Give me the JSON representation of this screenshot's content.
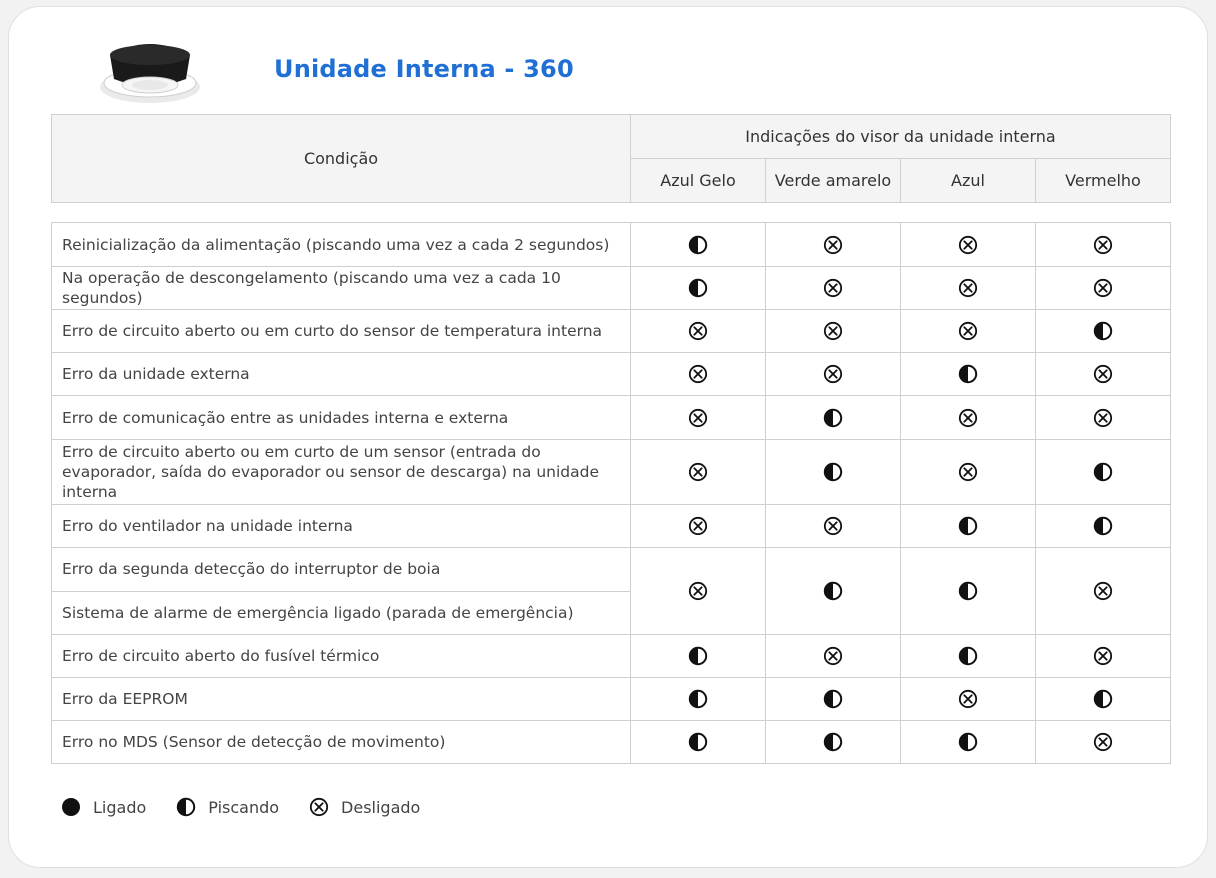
{
  "title": "Unidade Interna - 360",
  "header": {
    "condition_label": "Condição",
    "group_label": "Indicações do visor da unidade interna",
    "columns": [
      "Azul Gelo",
      "Verde amarelo",
      "Azul",
      "Vermelho"
    ]
  },
  "rows": [
    {
      "condition": "Reinicialização da alimentação (piscando uma vez a cada 2 segundos)",
      "states": [
        "blink",
        "off",
        "off",
        "off"
      ]
    },
    {
      "condition": "Na operação de descongelamento (piscando uma vez a cada 10 segundos)",
      "states": [
        "blink",
        "off",
        "off",
        "off"
      ]
    },
    {
      "condition": "Erro de circuito aberto ou em curto do sensor de temperatura interna",
      "states": [
        "off",
        "off",
        "off",
        "blink"
      ]
    },
    {
      "condition": "Erro da unidade externa",
      "states": [
        "off",
        "off",
        "blink",
        "off"
      ]
    },
    {
      "condition": "Erro de comunicação entre as unidades interna e externa",
      "states": [
        "off",
        "blink",
        "off",
        "off"
      ]
    },
    {
      "condition": "Erro de circuito aberto ou em curto de um sensor (entrada do evaporador, saída do evaporador ou sensor de descarga) na unidade interna",
      "states": [
        "off",
        "blink",
        "off",
        "blink"
      ]
    },
    {
      "condition": "Erro do ventilador na unidade interna",
      "states": [
        "off",
        "off",
        "blink",
        "blink"
      ]
    },
    {
      "condition": "Erro da segunda detecção do interruptor de boia",
      "condition2": "Sistema de alarme de emergência ligado (parada de emergência)",
      "states": [
        "off",
        "blink",
        "blink",
        "off"
      ]
    },
    {
      "condition": "Erro de circuito aberto do fusível térmico",
      "states": [
        "blink",
        "off",
        "blink",
        "off"
      ]
    },
    {
      "condition": "Erro da EEPROM",
      "states": [
        "blink",
        "blink",
        "off",
        "blink"
      ]
    },
    {
      "condition": "Erro no MDS (Sensor de detecção de movimento)",
      "states": [
        "blink",
        "blink",
        "blink",
        "off"
      ]
    }
  ],
  "legend": {
    "on": "Ligado",
    "blink": "Piscando",
    "off": "Desligado"
  },
  "icons": {
    "on": "filled-circle-icon",
    "blink": "half-filled-circle-icon",
    "off": "circled-x-icon"
  },
  "colors": {
    "title": "#1f6fd4",
    "header_bg": "#f4f4f4",
    "border": "#cfcfcf"
  }
}
